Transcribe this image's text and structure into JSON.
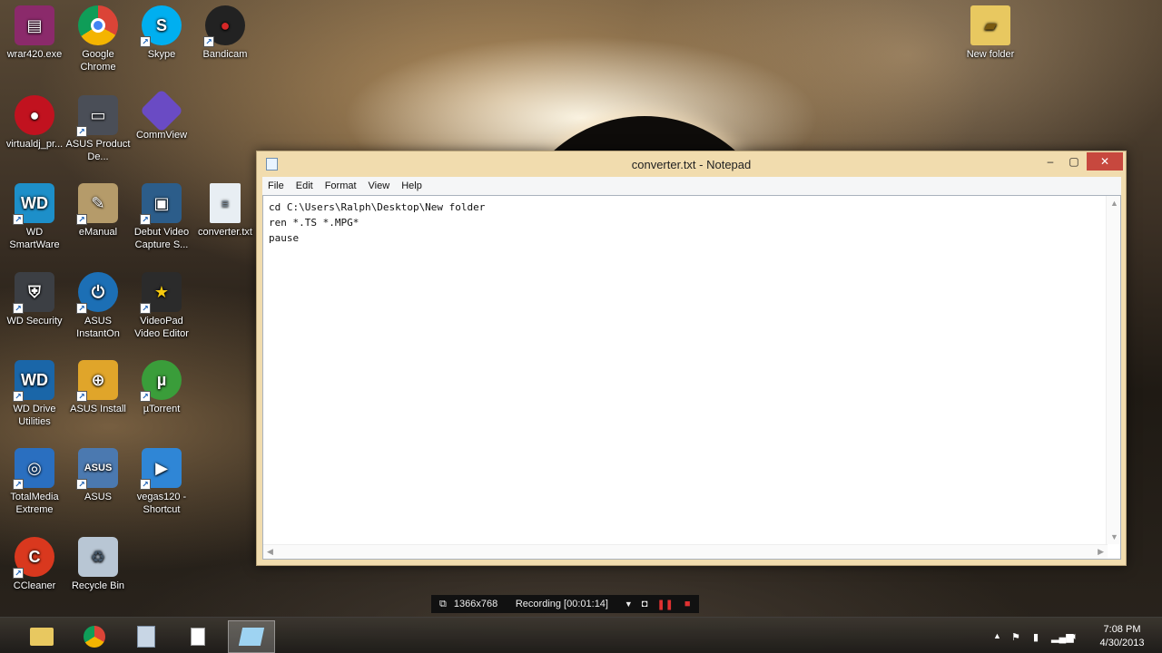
{
  "desktop": {
    "icons": [
      {
        "label": "wrar420.exe",
        "icon": "winrar-icon",
        "color": "#8b2a6b"
      },
      {
        "label": "Google Chrome",
        "icon": "chrome-icon",
        "color": "#2f9e44"
      },
      {
        "label": "Skype",
        "icon": "skype-icon",
        "color": "#00aff0"
      },
      {
        "label": "Bandicam",
        "icon": "bandicam-icon",
        "color": "#d62828"
      },
      {
        "label": "virtualdj_pr...",
        "icon": "virtualdj-icon",
        "color": "#c1121f"
      },
      {
        "label": "ASUS Product De...",
        "icon": "laptop-icon",
        "color": "#4a4e57"
      },
      {
        "label": "CommView",
        "icon": "commview-icon",
        "color": "#6a4bc4"
      },
      {
        "label": "WD SmartWare",
        "icon": "wd-smartware-icon",
        "color": "#1d8fc9"
      },
      {
        "label": "eManual",
        "icon": "manual-icon",
        "color": "#b59b6a"
      },
      {
        "label": "Debut Video Capture S...",
        "icon": "film-icon",
        "color": "#2c5d8a"
      },
      {
        "label": "converter.txt",
        "icon": "text-file-icon",
        "color": "#e8eef3"
      },
      {
        "label": "WD Security",
        "icon": "shield-icon",
        "color": "#3c3f44"
      },
      {
        "label": "ASUS InstantOn",
        "icon": "power-icon",
        "color": "#1c6fb5"
      },
      {
        "label": "VideoPad Video Editor",
        "icon": "star-film-icon",
        "color": "#2b2b2b"
      },
      {
        "label": "WD Drive Utilities",
        "icon": "drive-icon",
        "color": "#1a66a8"
      },
      {
        "label": "ASUS Install",
        "icon": "install-icon",
        "color": "#e0a52a"
      },
      {
        "label": "µTorrent",
        "icon": "utorrent-icon",
        "color": "#3a9d3a"
      },
      {
        "label": "TotalMedia Extreme",
        "icon": "disc-icon",
        "color": "#2a6fc0"
      },
      {
        "label": "ASUS",
        "icon": "asus-icon",
        "color": "#4b79b0"
      },
      {
        "label": "vegas120 - Shortcut",
        "icon": "play-icon",
        "color": "#2f86d6"
      },
      {
        "label": "CCleaner",
        "icon": "ccleaner-icon",
        "color": "#d9381e"
      },
      {
        "label": "Recycle Bin",
        "icon": "recycle-bin-icon",
        "color": "#b8c6d4"
      },
      {
        "label": "New folder",
        "icon": "folder-icon",
        "color": "#e8c860"
      }
    ]
  },
  "notepad": {
    "title": "converter.txt - Notepad",
    "menu": [
      "File",
      "Edit",
      "Format",
      "View",
      "Help"
    ],
    "content": "cd C:\\Users\\Ralph\\Desktop\\New folder\nren *.TS *.MPG*\npause"
  },
  "recording_bar": {
    "resolution": "1366x768",
    "status": "Recording [00:01:14]"
  },
  "taskbar": {
    "apps": [
      "file-explorer-icon",
      "chrome-icon",
      "calculator-icon",
      "document-icon",
      "notepad-icon"
    ],
    "active_app": "notepad-icon",
    "clock_time": "7:08 PM",
    "clock_date": "4/30/2013"
  }
}
